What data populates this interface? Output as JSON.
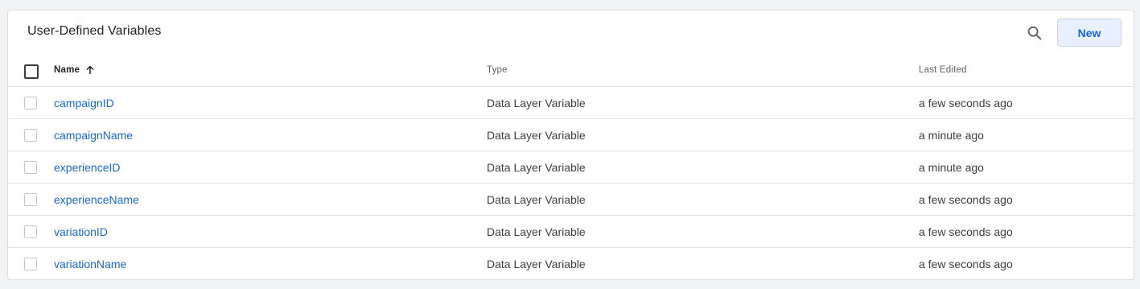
{
  "card": {
    "title": "User-Defined Variables",
    "new_label": "New"
  },
  "table": {
    "columns": {
      "name": "Name",
      "type": "Type",
      "last_edited": "Last Edited"
    },
    "rows": [
      {
        "name": "campaignID",
        "type": "Data Layer Variable",
        "last_edited": "a few seconds ago"
      },
      {
        "name": "campaignName",
        "type": "Data Layer Variable",
        "last_edited": "a minute ago"
      },
      {
        "name": "experienceID",
        "type": "Data Layer Variable",
        "last_edited": "a minute ago"
      },
      {
        "name": "experienceName",
        "type": "Data Layer Variable",
        "last_edited": "a few seconds ago"
      },
      {
        "name": "variationID",
        "type": "Data Layer Variable",
        "last_edited": "a few seconds ago"
      },
      {
        "name": "variationName",
        "type": "Data Layer Variable",
        "last_edited": "a few seconds ago"
      }
    ]
  },
  "icons": {
    "search": "search-icon",
    "sort": "arrow-up-icon"
  },
  "colors": {
    "link": "#1967d2",
    "button_bg": "#e8f0fe",
    "page_bg": "#f1f3f4"
  }
}
